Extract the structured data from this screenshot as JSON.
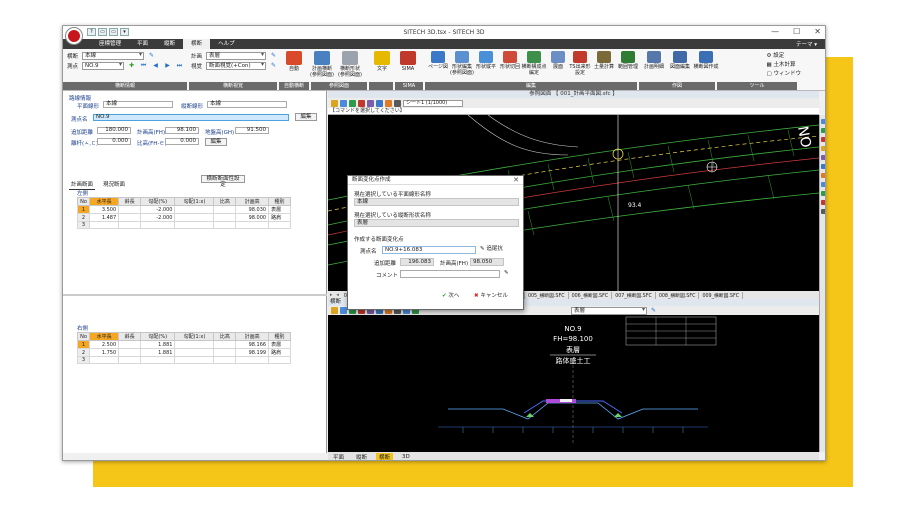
{
  "window": {
    "title": "SITECH 3D.tsx - SITECH 3D",
    "quick_access": [
      "?",
      "▭",
      "▭",
      "▾"
    ],
    "controls": [
      "—",
      "☐",
      "✕"
    ]
  },
  "menu": {
    "items": [
      "座標管理",
      "平面",
      "縦断",
      "横断",
      "ヘルプ"
    ],
    "active_index": 3,
    "theme": "テーマ ▾"
  },
  "ribbon": {
    "row1": {
      "label": "横断",
      "value": "本線"
    },
    "row2": {
      "label": "測点",
      "value": "NO.9"
    },
    "plan": {
      "label": "計画",
      "value": "表層"
    },
    "view": {
      "label": "視覚",
      "value": "断面視覚(+Con)"
    },
    "buttons": [
      {
        "label": "自動",
        "color": "#d84a2a"
      },
      {
        "label": "計画横断\n(参照図面)",
        "color": "#4a7fc0"
      },
      {
        "label": "横断形状\n(参照図面)",
        "color": "#9aa3ad"
      },
      {
        "label": "文字",
        "color": "#e6b800"
      },
      {
        "label": "SIMA",
        "color": "#c0392b"
      },
      {
        "label": "ページ図",
        "color": "#3c78c8"
      },
      {
        "label": "形状編集\n(参照図面)",
        "color": "#5a8fd0"
      },
      {
        "label": "形状縦平",
        "color": "#4a90d9"
      },
      {
        "label": "形状切回",
        "color": "#d04a3a"
      },
      {
        "label": "横断構成点\n編定",
        "color": "#3d8f4a"
      },
      {
        "label": "展面",
        "color": "#6b8fc4"
      },
      {
        "label": "TS出来形\n設定",
        "color": "#c23a2c"
      },
      {
        "label": "土量計算",
        "color": "#7a6a3a"
      },
      {
        "label": "範囲管理",
        "color": "#2e7d32"
      },
      {
        "label": "計画明細",
        "color": "#5577aa"
      },
      {
        "label": "図面編集",
        "color": "#4169a8"
      },
      {
        "label": "横断図作成",
        "color": "#3a6fb5"
      }
    ],
    "group_labels": [
      "横断情報",
      "横断視覚",
      "自動横断",
      "参照図面",
      "SIMA",
      "ページ",
      "編集",
      "計算",
      "作図",
      "ツール"
    ],
    "side_links": [
      "設定",
      "土木計算",
      "ウィンドウ"
    ]
  },
  "left": {
    "section": "路線情報",
    "plan_alignment_label": "平面線形",
    "plan_alignment": "本線",
    "profile_alignment_label": "縦断線形",
    "profile_alignment": "本線",
    "edit_label": "編集",
    "station_label": "測点名",
    "station": "NO.9",
    "add_dist_label": "追加距離",
    "add_dist": "180.000",
    "plan_height_label": "計画高(FH)",
    "plan_height": "98.100",
    "ground_height_label": "地盤高(GH)",
    "ground_height": "91.500",
    "offset_label": "離杆(ㅅ,ㄷ)",
    "offset": "0.000",
    "ratio_label": "比高(FH-ㅌ)",
    "ratio": "0.000",
    "edit2_label": "編集",
    "tabs": [
      "計画断面",
      "現況断面"
    ],
    "active_tab": 0,
    "settings_btn": "横断断面性設定",
    "left_side": "左側",
    "right_side": "右側",
    "columns": [
      "No",
      "水平長",
      "斜長",
      "勾配(%)",
      "勾配(1:x)",
      "比高",
      "計画高",
      "種別"
    ],
    "left_rows": [
      [
        "1",
        "3.500",
        "",
        "-2.000",
        "",
        "",
        "98.030",
        "表層"
      ],
      [
        "2",
        "1.487",
        "",
        "-2.000",
        "",
        "",
        "98.000",
        "路肩"
      ],
      [
        "3",
        "",
        "",
        "",
        "",
        "",
        "",
        ""
      ]
    ],
    "right_rows": [
      [
        "1",
        "2.500",
        "",
        "1.881",
        "",
        "",
        "98.166",
        "表層"
      ],
      [
        "2",
        "1.750",
        "",
        "1.881",
        "",
        "",
        "98.199",
        "路肩"
      ],
      [
        "3",
        "",
        "",
        "",
        "",
        "",
        "",
        ""
      ]
    ]
  },
  "viewer": {
    "title": "参照図面 【 001_計画平面図.sfc 】",
    "sheet": "シート1 (1/1000)",
    "command": "【コマンドを選択してください】",
    "plan_labels": [
      "NO",
      "NO.9",
      "93.4"
    ],
    "sheet_tabs": [
      "▸",
      "◂",
      "001_計画平面図.SFC",
      "002_横断図.SFC",
      "003_横断図.SFC",
      "004_横断図.SFC",
      "005_横断図.SFC",
      "006_横断図.SFC",
      "007_横断図.SFC",
      "008_横断図.SFC",
      "009_横断図.SFC"
    ],
    "section_title": "横断",
    "section_combo": "表層",
    "section_labels": {
      "station": "NO.9",
      "fh": "FH=98.100",
      "layer1": "表層",
      "layer2": "路体盛土工"
    },
    "bottom_tabs": [
      "平面",
      "縦断",
      "横断",
      "3D"
    ],
    "active_bottom": 2
  },
  "dialog": {
    "title": "断面変化点作成",
    "plan_label": "現在選択している平面線形名称",
    "plan_value": "本線",
    "profile_label": "現在選択している縦断形状名称",
    "profile_value": "表層",
    "create_label": "作成する断面変化点",
    "station_label": "測点名",
    "station_value": "NO.9+16.083",
    "pick_label": "追尾抗",
    "add_dist_label": "追加距離",
    "add_dist_value": "196.083",
    "fh_label": "計画高(FH)",
    "fh_value": "98.050",
    "comment_label": "コメント",
    "comment_value": "",
    "ok_label": "次へ",
    "cancel_label": "キャンセル"
  }
}
